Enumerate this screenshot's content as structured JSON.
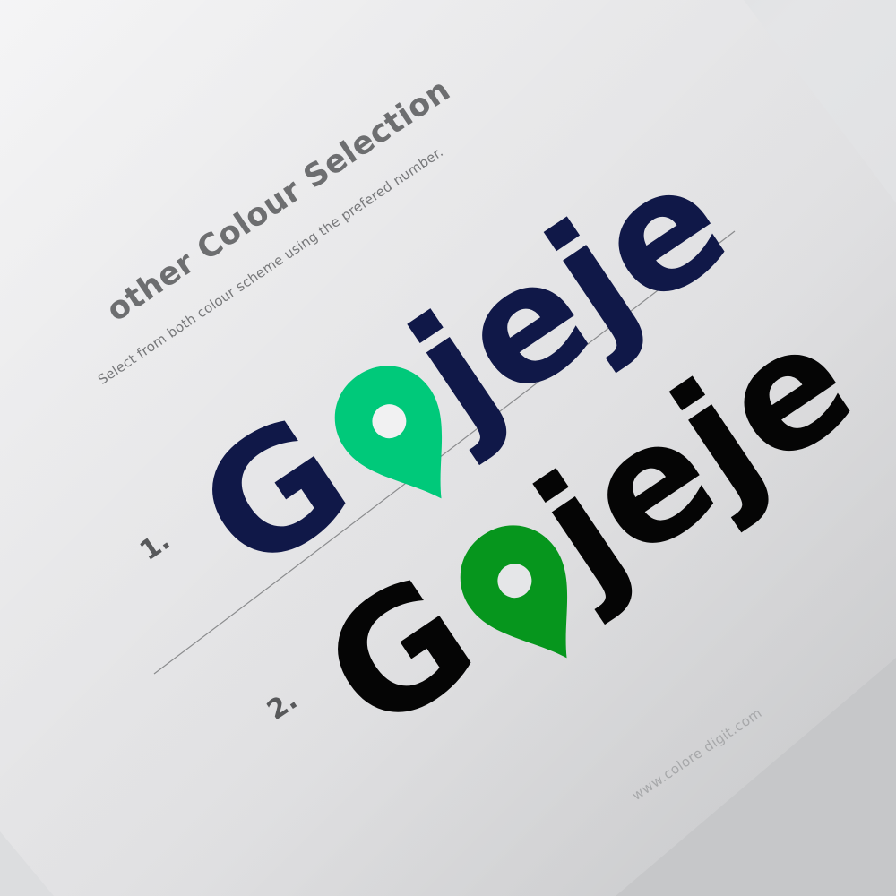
{
  "heading": {
    "title": "other Colour Selection",
    "subtitle": "Select from both colour scheme using the prefered number."
  },
  "options": [
    {
      "number": "1.",
      "logo_first": "G",
      "logo_rest": "jeje",
      "text_color": "#101848",
      "pin_color": "#00c97a",
      "pin_hole_color": "#f1f1f2"
    },
    {
      "number": "2.",
      "logo_first": "G",
      "logo_rest": "jeje",
      "text_color": "#050505",
      "pin_color": "#06961d",
      "pin_hole_color": "#e5e6e8"
    }
  ],
  "footer": {
    "website": "www.colore digit.com"
  },
  "colors": {
    "page": "#f1f1f2",
    "page_shadow": "#d0d1d3",
    "background": "#d6d7d9",
    "divider": "#8b8c8e"
  }
}
